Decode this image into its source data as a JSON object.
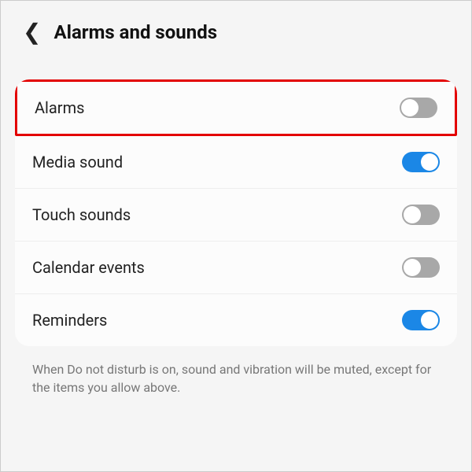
{
  "header": {
    "title": "Alarms and sounds"
  },
  "settings": {
    "alarms": {
      "label": "Alarms",
      "on": false,
      "highlighted": true
    },
    "media": {
      "label": "Media sound",
      "on": true
    },
    "touch": {
      "label": "Touch sounds",
      "on": false
    },
    "calendar": {
      "label": "Calendar events",
      "on": false
    },
    "reminders": {
      "label": "Reminders",
      "on": true
    }
  },
  "footer": "When Do not disturb is on, sound and vibration will be muted, except for the items you allow above."
}
